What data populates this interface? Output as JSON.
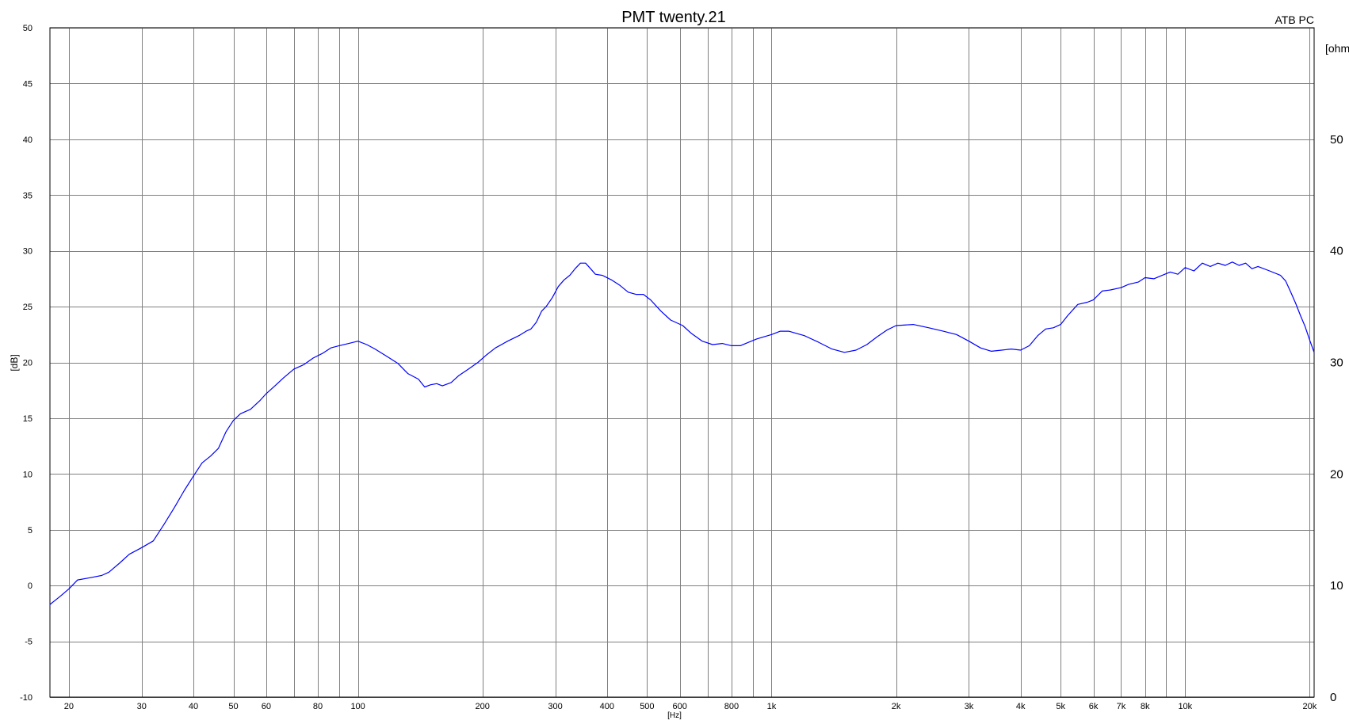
{
  "chart_data": {
    "type": "line",
    "title": "PMT twenty.21",
    "corner_label": "ATB PC",
    "xlabel": "[Hz]",
    "ylabel": "[dB]",
    "y2label": "[ohm]",
    "x_scale": "log",
    "xlim": [
      18,
      20500
    ],
    "ylim": [
      -10,
      50
    ],
    "y2lim": [
      0,
      60
    ],
    "grid": true,
    "x_ticks": [
      20,
      30,
      40,
      50,
      60,
      80,
      100,
      200,
      300,
      400,
      500,
      600,
      800,
      1000,
      2000,
      3000,
      4000,
      5000,
      6000,
      7000,
      8000,
      10000,
      20000
    ],
    "x_tick_labels": [
      "20",
      "30",
      "40",
      "50",
      "60",
      "80",
      "100",
      "200",
      "300",
      "400",
      "500",
      "600",
      "800",
      "1k",
      "2k",
      "3k",
      "4k",
      "5k",
      "6k",
      "7k",
      "8k",
      "10k",
      "20k"
    ],
    "x_gridlines": [
      20,
      30,
      40,
      50,
      60,
      70,
      80,
      90,
      100,
      200,
      300,
      400,
      500,
      600,
      700,
      800,
      900,
      1000,
      2000,
      3000,
      4000,
      5000,
      6000,
      7000,
      8000,
      9000,
      10000,
      20000
    ],
    "y_ticks": [
      50,
      45,
      40,
      35,
      30,
      25,
      20,
      15,
      10,
      5,
      0,
      -5,
      -10
    ],
    "y_tick_labels": [
      "50",
      "45",
      "40",
      "35",
      "30",
      "25",
      "20",
      "15",
      "10",
      "5",
      "0",
      "-5",
      "-10"
    ],
    "y2_ticks": [
      50,
      40,
      30,
      20,
      10,
      0
    ],
    "y2_tick_labels": [
      "50",
      "40",
      "30",
      "20",
      "10",
      "0"
    ],
    "series": [
      {
        "color": "#0000ff",
        "points": [
          [
            18,
            -1.7
          ],
          [
            19,
            -1.0
          ],
          [
            20,
            -0.3
          ],
          [
            21,
            0.5
          ],
          [
            22.5,
            0.7
          ],
          [
            24,
            0.9
          ],
          [
            25,
            1.2
          ],
          [
            26.5,
            2.0
          ],
          [
            28,
            2.8
          ],
          [
            30,
            3.4
          ],
          [
            32,
            4.0
          ],
          [
            34,
            5.5
          ],
          [
            36,
            7.0
          ],
          [
            38,
            8.5
          ],
          [
            40,
            9.8
          ],
          [
            42,
            11.0
          ],
          [
            44,
            11.6
          ],
          [
            46,
            12.3
          ],
          [
            48,
            13.8
          ],
          [
            50,
            14.8
          ],
          [
            52,
            15.4
          ],
          [
            55,
            15.8
          ],
          [
            58,
            16.6
          ],
          [
            60,
            17.2
          ],
          [
            63,
            17.9
          ],
          [
            66,
            18.6
          ],
          [
            70,
            19.4
          ],
          [
            74,
            19.8
          ],
          [
            78,
            20.4
          ],
          [
            82,
            20.8
          ],
          [
            86,
            21.3
          ],
          [
            90,
            21.5
          ],
          [
            95,
            21.7
          ],
          [
            100,
            21.9
          ],
          [
            105,
            21.6
          ],
          [
            110,
            21.2
          ],
          [
            118,
            20.5
          ],
          [
            125,
            19.9
          ],
          [
            132,
            19.0
          ],
          [
            140,
            18.5
          ],
          [
            145,
            17.8
          ],
          [
            150,
            18.0
          ],
          [
            155,
            18.1
          ],
          [
            160,
            17.9
          ],
          [
            168,
            18.2
          ],
          [
            175,
            18.8
          ],
          [
            185,
            19.4
          ],
          [
            195,
            20.0
          ],
          [
            205,
            20.7
          ],
          [
            215,
            21.3
          ],
          [
            230,
            21.9
          ],
          [
            245,
            22.4
          ],
          [
            255,
            22.8
          ],
          [
            262,
            23.0
          ],
          [
            270,
            23.6
          ],
          [
            278,
            24.6
          ],
          [
            285,
            25.0
          ],
          [
            295,
            25.8
          ],
          [
            305,
            26.8
          ],
          [
            315,
            27.4
          ],
          [
            325,
            27.8
          ],
          [
            335,
            28.4
          ],
          [
            345,
            28.9
          ],
          [
            355,
            28.9
          ],
          [
            365,
            28.4
          ],
          [
            375,
            27.9
          ],
          [
            390,
            27.8
          ],
          [
            410,
            27.4
          ],
          [
            430,
            26.9
          ],
          [
            450,
            26.3
          ],
          [
            470,
            26.1
          ],
          [
            490,
            26.1
          ],
          [
            510,
            25.6
          ],
          [
            540,
            24.6
          ],
          [
            570,
            23.8
          ],
          [
            610,
            23.3
          ],
          [
            640,
            22.6
          ],
          [
            680,
            21.9
          ],
          [
            720,
            21.6
          ],
          [
            760,
            21.7
          ],
          [
            800,
            21.5
          ],
          [
            840,
            21.5
          ],
          [
            880,
            21.8
          ],
          [
            920,
            22.1
          ],
          [
            960,
            22.3
          ],
          [
            1000,
            22.5
          ],
          [
            1050,
            22.8
          ],
          [
            1100,
            22.8
          ],
          [
            1150,
            22.6
          ],
          [
            1200,
            22.4
          ],
          [
            1300,
            21.8
          ],
          [
            1400,
            21.2
          ],
          [
            1500,
            20.9
          ],
          [
            1600,
            21.1
          ],
          [
            1700,
            21.6
          ],
          [
            1800,
            22.3
          ],
          [
            1900,
            22.9
          ],
          [
            2000,
            23.3
          ],
          [
            2200,
            23.4
          ],
          [
            2400,
            23.1
          ],
          [
            2600,
            22.8
          ],
          [
            2800,
            22.5
          ],
          [
            3000,
            21.9
          ],
          [
            3200,
            21.3
          ],
          [
            3400,
            21.0
          ],
          [
            3600,
            21.1
          ],
          [
            3800,
            21.2
          ],
          [
            4000,
            21.1
          ],
          [
            4200,
            21.5
          ],
          [
            4400,
            22.4
          ],
          [
            4600,
            23.0
          ],
          [
            4800,
            23.1
          ],
          [
            5000,
            23.4
          ],
          [
            5200,
            24.2
          ],
          [
            5500,
            25.2
          ],
          [
            5800,
            25.4
          ],
          [
            6000,
            25.6
          ],
          [
            6300,
            26.4
          ],
          [
            6600,
            26.5
          ],
          [
            7000,
            26.7
          ],
          [
            7300,
            27.0
          ],
          [
            7700,
            27.2
          ],
          [
            8000,
            27.6
          ],
          [
            8400,
            27.5
          ],
          [
            8800,
            27.8
          ],
          [
            9200,
            28.1
          ],
          [
            9600,
            27.9
          ],
          [
            10000,
            28.5
          ],
          [
            10500,
            28.2
          ],
          [
            11000,
            28.9
          ],
          [
            11500,
            28.6
          ],
          [
            12000,
            28.9
          ],
          [
            12500,
            28.7
          ],
          [
            13000,
            29.0
          ],
          [
            13500,
            28.7
          ],
          [
            14000,
            28.9
          ],
          [
            14500,
            28.4
          ],
          [
            15000,
            28.6
          ],
          [
            16000,
            28.2
          ],
          [
            17000,
            27.8
          ],
          [
            17500,
            27.3
          ],
          [
            18000,
            26.3
          ],
          [
            18500,
            25.3
          ],
          [
            19000,
            24.2
          ],
          [
            19500,
            23.2
          ],
          [
            20000,
            22.0
          ],
          [
            20500,
            20.9
          ]
        ]
      }
    ]
  }
}
